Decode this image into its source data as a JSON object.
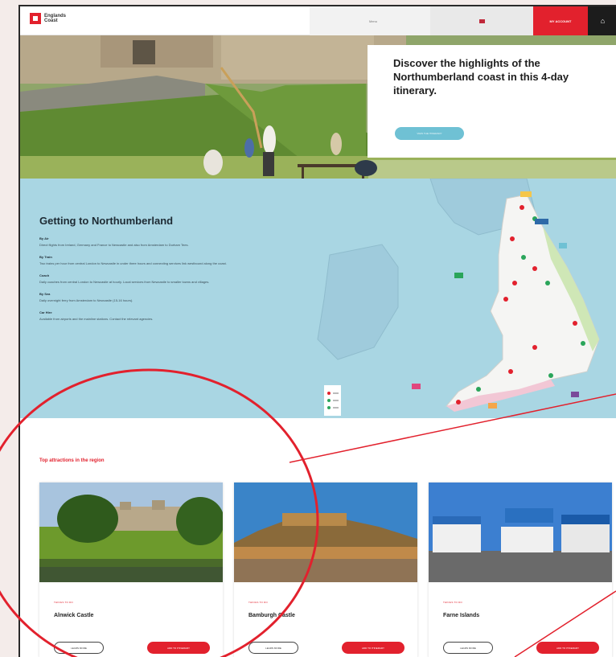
{
  "header": {
    "logo_text": "Englands Coast",
    "search_label": "Menu",
    "account_label": "MY ACCOUNT",
    "home_icon": "home-icon"
  },
  "hero": {
    "title": "Discover the highlights of the Northumberland coast in this 4-day itinerary.",
    "button_label": "VIEW THE ITINERARY"
  },
  "getting": {
    "title": "Getting to Northumberland",
    "sections": [
      {
        "heading": "By Air",
        "text": "Direct flights from Ireland, Germany and France to Newcastle and also from Amsterdam to Durham Tees."
      },
      {
        "heading": "By Train",
        "text": "Two trains per hour from central London to Newcastle in under three hours and connecting services link westbound along the coast."
      },
      {
        "heading": "Coach",
        "text": "Daily coaches from central London to Newcastle at hourly. Local services from Newcastle to smaller towns and villages."
      },
      {
        "heading": "By Sea",
        "text": "Daily overnight ferry from Amsterdam to Newcastle (15-16 hours)."
      },
      {
        "heading": "Car Hire",
        "text": "Available from airports and the mainline stations. Contact the relevant agencies."
      }
    ]
  },
  "attractions": {
    "title": "Top attractions in the region",
    "cards": [
      {
        "tag": "THINGS TO DO",
        "name": "Alnwick Castle",
        "learn": "LEARN MORE",
        "add": "ADD TO ITINERARY"
      },
      {
        "tag": "THINGS TO DO",
        "name": "Bamburgh Castle",
        "learn": "LEARN MORE",
        "add": "ADD TO ITINERARY"
      },
      {
        "tag": "THINGS TO DO",
        "name": "Farne Islands",
        "learn": "LEARN MORE",
        "add": "ADD TO ITINERARY"
      }
    ]
  },
  "colors": {
    "accent": "#e2212d",
    "map_sea": "#a9d6e3",
    "button_blue": "#6fc1d4"
  }
}
